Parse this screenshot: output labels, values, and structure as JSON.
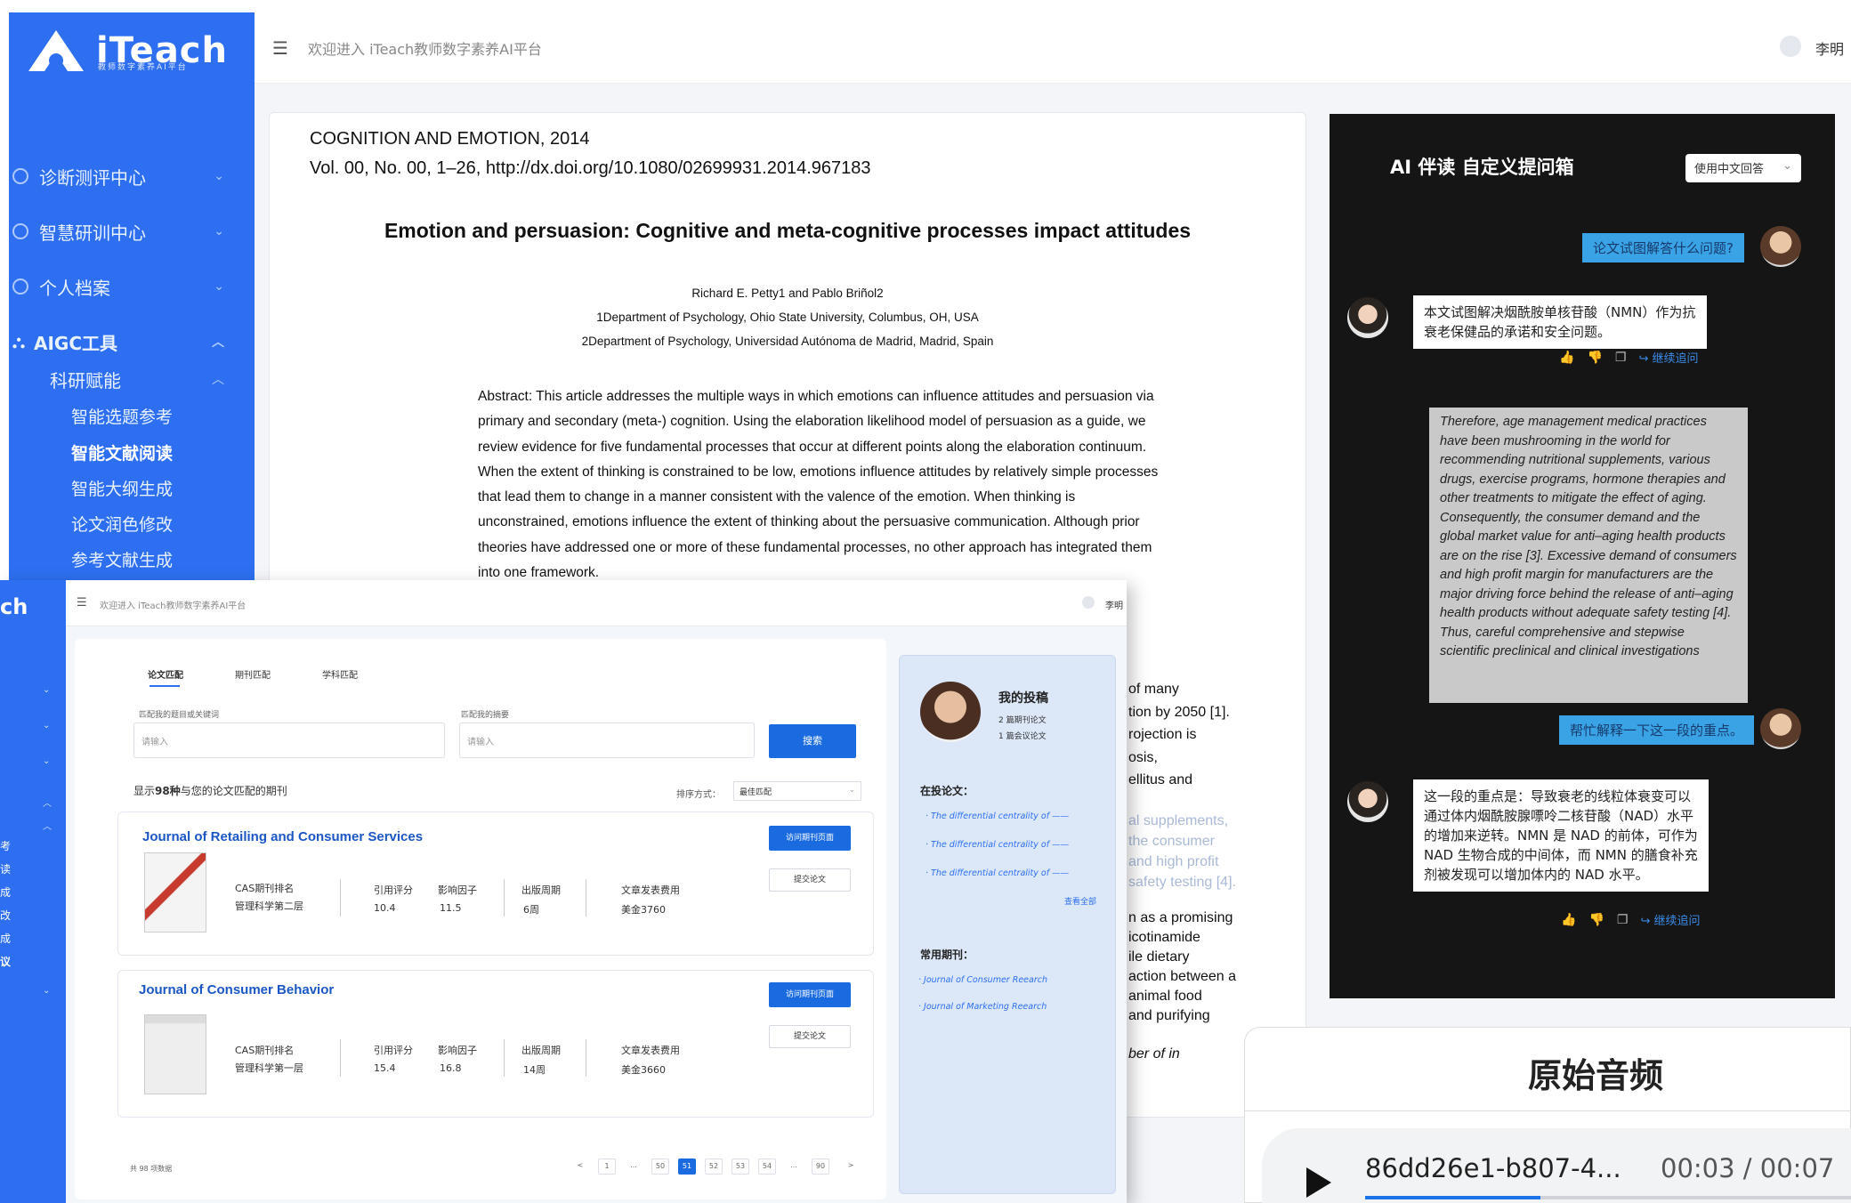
{
  "app": {
    "logo_text": "iTeach",
    "logo_sub": "教师数字素养AI平台",
    "welcome": "欢迎进入 iTeach教师数字素养AI平台",
    "user": "李明"
  },
  "sidebar": {
    "items": [
      {
        "label": "诊断测评中心"
      },
      {
        "label": "智慧研训中心"
      },
      {
        "label": "个人档案"
      },
      {
        "label": "AIGC工具"
      }
    ],
    "group": "科研赋能",
    "subitems": [
      {
        "label": "智能选题参考"
      },
      {
        "label": "智能文献阅读"
      },
      {
        "label": "智能大纲生成"
      },
      {
        "label": "论文润色修改"
      },
      {
        "label": "参考文献生成"
      }
    ]
  },
  "paper": {
    "journal": "COGNITION AND EMOTION, 2014",
    "volume": "Vol. 00, No. 00, 1–26, http://dx.doi.org/10.1080/02699931.2014.967183",
    "title": "Emotion and persuasion: Cognitive and meta-cognitive processes impact attitudes",
    "authors": "Richard E. Petty1 and Pablo Briñol2",
    "aff1": "1Department of Psychology, Ohio State University, Columbus, OH, USA",
    "aff2": "2Department of Psychology, Universidad Autónoma de Madrid, Madrid, Spain",
    "abstract": "Abstract: This article addresses the multiple ways in which emotions can influence attitudes and persuasion via primary and secondary (meta-) cognition. Using the elaboration likelihood model of persuasion as a guide, we review evidence for five fundamental processes that occur at different points along the elaboration continuum. When the extent of thinking is constrained to be low, emotions influence attitudes by relatively simple processes that lead them to change in a manner consistent with the valence of the emotion.  When thinking is unconstrained, emotions influence the extent of thinking about the persuasive communication. Although prior theories have addressed one or more of these fundamental processes, no other approach has integrated them into one framework.",
    "fragments": [
      "of many",
      "tion by 2050 [1].",
      "rojection is",
      "osis,",
      "ellitus and",
      "al supplements,",
      "the consumer",
      "and high profit",
      "safety testing [4].",
      "n as a promising",
      "icotinamide",
      "ile dietary",
      "action between a",
      "animal food",
      "and purifying",
      "ber of in"
    ]
  },
  "ai_panel": {
    "title": "AI 伴读  自定义提问箱",
    "lang": "使用中文回答",
    "q1": "论文试图解答什么问题?",
    "a1": "本文试图解决烟酰胺单核苷酸（NMN）作为抗衰老保健品的承诺和安全问题。",
    "quote": "Therefore, age management medical practices have been mushrooming in the world for recommending nutritional supplements, various drugs, exercise programs, hormone therapies and other treatments to mitigate the effect of aging. Consequently, the consumer demand and the global market value for anti–aging health products are on the rise [3]. Excessive demand of consumers and high profit margin for manufacturers are the major driving force behind the release of anti–aging health products without adequate safety testing [4]. Thus, careful comprehensive and stepwise scientific preclinical and clinical investigations",
    "q2": "帮忙解释一下这一段的重点。",
    "a2": "这一段的重点是：导致衰老的线粒体衰变可以通过体内烟酰胺腺嘌呤二核苷酸（NAD）水平的增加来逆转。NMN 是 NAD 的前体，可作为 NAD 生物合成的中间体，而 NMN 的膳食补充剂被发现可以增加体内的 NAD 水平。",
    "continue": "继续追问"
  },
  "audio": {
    "title": "原始音频",
    "file": "86dd26e1-b807-4...",
    "time": "00:03 / 00:07",
    "progress": 0.36
  },
  "front": {
    "tabs": [
      "论文匹配",
      "期刊匹配",
      "学科匹配"
    ],
    "field1_label": "匹配我的题目或关键词",
    "field2_label": "匹配我的摘要",
    "placeholder": "请输入",
    "search": "搜索",
    "result_prefix": "显示",
    "result_count": "98种",
    "result_suffix": "与您的论文匹配的期刊",
    "sort_label": "排序方式：",
    "sort_value": "最佳匹配",
    "visit": "访问期刊页面",
    "submit": "提交论文",
    "labels": {
      "cas": "CAS期刊排名",
      "cite": "引用评分",
      "impact": "影响因子",
      "cycle": "出版周期",
      "fee": "文章发表费用"
    },
    "journals": [
      {
        "name": "Journal of Retailing and Consumer Services",
        "cas": "管理科学第二层",
        "cite": "10.4",
        "impact": "11.5",
        "cycle": "6周",
        "fee": "美金3760"
      },
      {
        "name": "Journal of Consumer Behavior",
        "cas": "管理科学第一层",
        "cite": "15.4",
        "impact": "16.8",
        "cycle": "14周",
        "fee": "美金3660"
      }
    ],
    "pager_total": "共 98 项数据",
    "pages": [
      "<",
      "1",
      "...",
      "50",
      "51",
      "52",
      "53",
      "54",
      "...",
      "90",
      ">"
    ],
    "current_page": "51",
    "my": {
      "title": "我的投稿",
      "count1": "2 篇期刊论文",
      "count2": "1 篇会议论文",
      "under_review": "在投论文：",
      "papers": [
        "The differential centrality of ——",
        "The differential centrality of ——",
        "The differential centrality of ——"
      ],
      "see_all": "查看全部",
      "common": "常用期刊：",
      "journals": [
        "Journal of Consumer Reearch",
        "Journal of Marketing Reearch"
      ]
    },
    "side": {
      "logo": "ch",
      "labels": [
        "考",
        "读",
        "成",
        "改",
        "成",
        "议"
      ]
    }
  }
}
